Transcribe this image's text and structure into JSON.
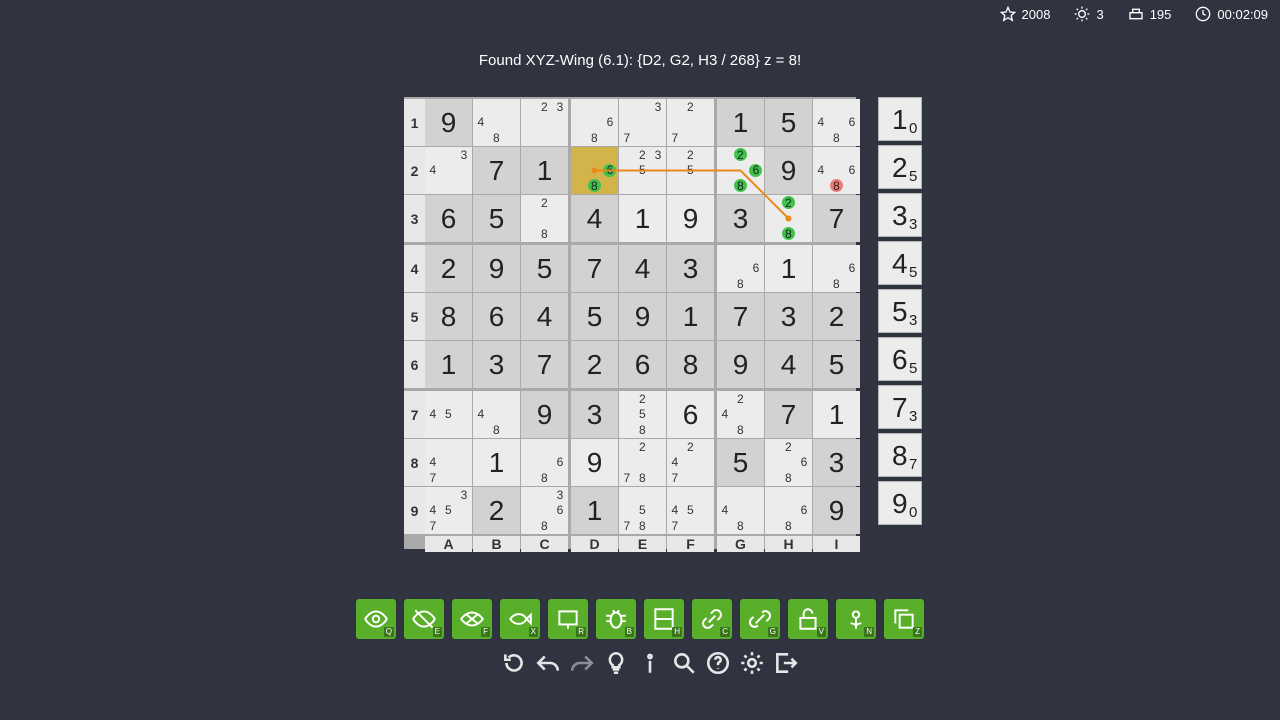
{
  "stats": {
    "score": "2008",
    "hints": "3",
    "moves": "195",
    "time": "00:02:09"
  },
  "hint_text": "Found XYZ-Wing (6.1): {D2, G2, H3 / 268} z = 8!",
  "row_labels": [
    "1",
    "2",
    "3",
    "4",
    "5",
    "6",
    "7",
    "8",
    "9"
  ],
  "col_labels": [
    "A",
    "B",
    "C",
    "D",
    "E",
    "F",
    "G",
    "H",
    "I"
  ],
  "grid": [
    [
      {
        "v": "9",
        "t": "given"
      },
      {
        "c": [
          4,
          8
        ]
      },
      {
        "c": [
          2,
          3
        ]
      },
      {
        "c": [
          6,
          8
        ]
      },
      {
        "c": [
          3,
          7
        ]
      },
      {
        "c": [
          2,
          7
        ]
      },
      {
        "v": "1",
        "t": "given"
      },
      {
        "v": "5",
        "t": "given"
      },
      {
        "c": [
          4,
          6,
          8
        ]
      }
    ],
    [
      {
        "c": [
          3,
          4
        ]
      },
      {
        "v": "7",
        "t": "given"
      },
      {
        "v": "1",
        "t": "given"
      },
      {
        "c": [
          6,
          8
        ],
        "hl": true,
        "green": [
          6,
          8
        ]
      },
      {
        "c": [
          2,
          3,
          5
        ]
      },
      {
        "c": [
          2,
          5
        ]
      },
      {
        "c": [
          2,
          6,
          8
        ],
        "green": [
          2,
          6,
          8
        ]
      },
      {
        "v": "9",
        "t": "given"
      },
      {
        "c": [
          4,
          6,
          8
        ],
        "red": [
          8
        ]
      }
    ],
    [
      {
        "v": "6",
        "t": "given"
      },
      {
        "v": "5",
        "t": "given"
      },
      {
        "c": [
          2,
          8
        ]
      },
      {
        "v": "4",
        "t": "given"
      },
      {
        "v": "1",
        "t": "user"
      },
      {
        "v": "9",
        "t": "user"
      },
      {
        "v": "3",
        "t": "given"
      },
      {
        "c": [
          2,
          8
        ],
        "green": [
          2,
          8
        ]
      },
      {
        "v": "7",
        "t": "given"
      }
    ],
    [
      {
        "v": "2",
        "t": "given"
      },
      {
        "v": "9",
        "t": "given"
      },
      {
        "v": "5",
        "t": "given"
      },
      {
        "v": "7",
        "t": "given"
      },
      {
        "v": "4",
        "t": "given"
      },
      {
        "v": "3",
        "t": "given"
      },
      {
        "c": [
          6,
          8
        ]
      },
      {
        "v": "1",
        "t": "user"
      },
      {
        "c": [
          6,
          8
        ]
      }
    ],
    [
      {
        "v": "8",
        "t": "given"
      },
      {
        "v": "6",
        "t": "given"
      },
      {
        "v": "4",
        "t": "given"
      },
      {
        "v": "5",
        "t": "given"
      },
      {
        "v": "9",
        "t": "given"
      },
      {
        "v": "1",
        "t": "given"
      },
      {
        "v": "7",
        "t": "given"
      },
      {
        "v": "3",
        "t": "given"
      },
      {
        "v": "2",
        "t": "given"
      }
    ],
    [
      {
        "v": "1",
        "t": "given"
      },
      {
        "v": "3",
        "t": "given"
      },
      {
        "v": "7",
        "t": "given"
      },
      {
        "v": "2",
        "t": "given"
      },
      {
        "v": "6",
        "t": "given"
      },
      {
        "v": "8",
        "t": "given"
      },
      {
        "v": "9",
        "t": "given"
      },
      {
        "v": "4",
        "t": "given"
      },
      {
        "v": "5",
        "t": "given"
      }
    ],
    [
      {
        "c": [
          4,
          5
        ]
      },
      {
        "c": [
          4,
          8
        ]
      },
      {
        "v": "9",
        "t": "given"
      },
      {
        "v": "3",
        "t": "given"
      },
      {
        "c": [
          2,
          5,
          8
        ]
      },
      {
        "v": "6",
        "t": "user"
      },
      {
        "c": [
          2,
          4,
          8
        ]
      },
      {
        "v": "7",
        "t": "given"
      },
      {
        "v": "1",
        "t": "user"
      }
    ],
    [
      {
        "c": [
          4,
          7
        ]
      },
      {
        "v": "1",
        "t": "user"
      },
      {
        "c": [
          6,
          8
        ]
      },
      {
        "v": "9",
        "t": "user"
      },
      {
        "c": [
          2,
          7,
          8
        ]
      },
      {
        "c": [
          2,
          4,
          7
        ]
      },
      {
        "v": "5",
        "t": "given"
      },
      {
        "c": [
          2,
          6,
          8
        ]
      },
      {
        "v": "3",
        "t": "given"
      }
    ],
    [
      {
        "c": [
          3,
          4,
          5,
          7
        ]
      },
      {
        "v": "2",
        "t": "given"
      },
      {
        "c": [
          3,
          6,
          8
        ]
      },
      {
        "v": "1",
        "t": "given"
      },
      {
        "c": [
          5,
          7,
          8
        ]
      },
      {
        "c": [
          4,
          5,
          7
        ]
      },
      {
        "c": [
          4,
          8
        ]
      },
      {
        "c": [
          6,
          8
        ]
      },
      {
        "v": "9",
        "t": "given"
      }
    ]
  ],
  "chain": [
    [
      3,
      1,
      6
    ],
    [
      6,
      1,
      6
    ],
    [
      7,
      2,
      5
    ]
  ],
  "palette": [
    {
      "digit": "1",
      "count": "0"
    },
    {
      "digit": "2",
      "count": "5"
    },
    {
      "digit": "3",
      "count": "3"
    },
    {
      "digit": "4",
      "count": "5"
    },
    {
      "digit": "5",
      "count": "3"
    },
    {
      "digit": "6",
      "count": "5"
    },
    {
      "digit": "7",
      "count": "3"
    },
    {
      "digit": "8",
      "count": "7"
    },
    {
      "digit": "9",
      "count": "0"
    }
  ],
  "tools": [
    {
      "name": "show-candidates",
      "key": "Q",
      "icon": "eye-icon"
    },
    {
      "name": "hide-candidates",
      "key": "E",
      "icon": "eye-off-icon"
    },
    {
      "name": "fill-candidates",
      "key": "F",
      "icon": "fish-eye-icon"
    },
    {
      "name": "x-wing",
      "key": "X",
      "icon": "fish-icon"
    },
    {
      "name": "rectangle",
      "key": "R",
      "icon": "rectangle-icon"
    },
    {
      "name": "bug",
      "key": "B",
      "icon": "bug-icon"
    },
    {
      "name": "hidden",
      "key": "H",
      "icon": "split-box-icon"
    },
    {
      "name": "chain",
      "key": "C",
      "icon": "link-icon"
    },
    {
      "name": "grouped-chain",
      "key": "G",
      "icon": "double-link-icon"
    },
    {
      "name": "unlock",
      "key": "V",
      "icon": "unlock-icon"
    },
    {
      "name": "nice-loop",
      "key": "N",
      "icon": "flower-icon"
    },
    {
      "name": "copy",
      "key": "Z",
      "icon": "copy-icon"
    }
  ],
  "bottom_icons": [
    "restart-icon",
    "undo-icon",
    "redo-icon",
    "lightbulb-icon",
    "info-icon",
    "search-icon",
    "help-icon",
    "gear-icon",
    "exit-icon"
  ],
  "colors": {
    "bg": "#2f3440",
    "given": "#d2d2d2",
    "empty": "#ececec",
    "highlight": "#d3b44a",
    "green": "#3fc24b",
    "red": "#f07a7a",
    "chain": "#e8891c",
    "tool": "#5aaf2a"
  }
}
